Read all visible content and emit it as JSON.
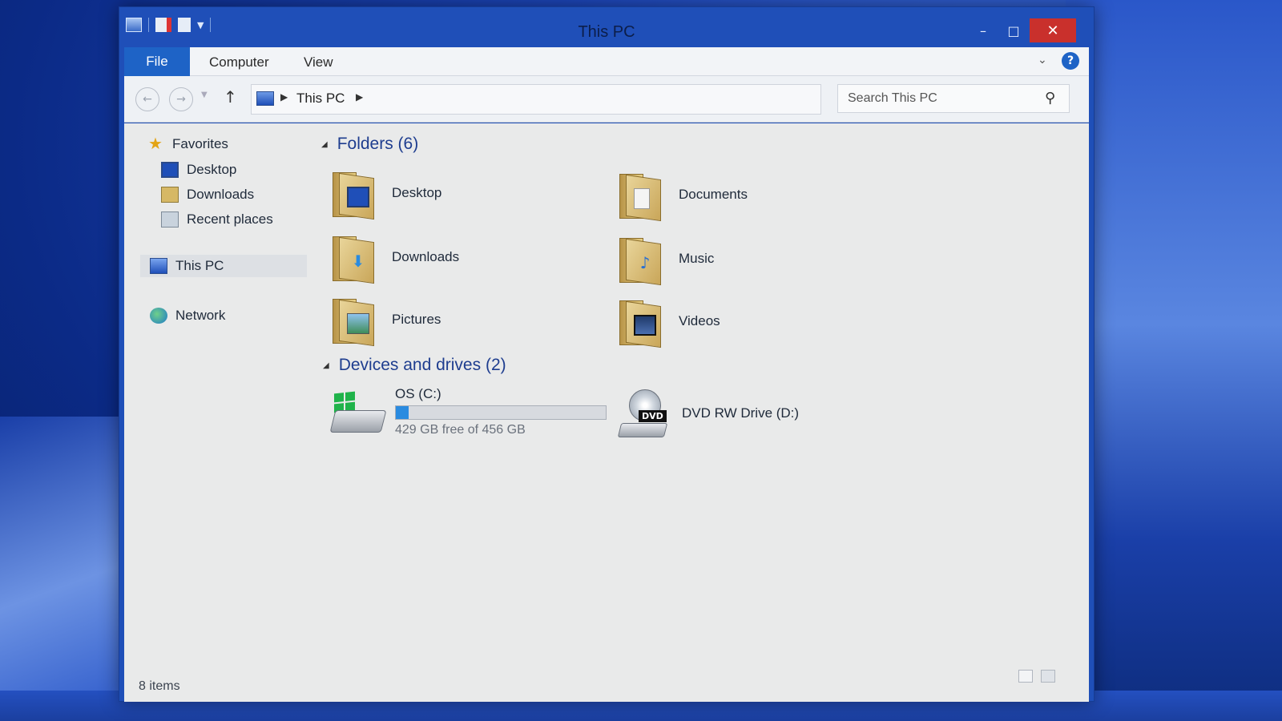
{
  "window": {
    "title": "This PC",
    "controls": {
      "minimize": "–",
      "maximize": "□",
      "close": "✕"
    }
  },
  "ribbon": {
    "tabs": [
      "File",
      "Computer",
      "View"
    ],
    "help": "?"
  },
  "address": {
    "crumb": "This PC",
    "search_placeholder": "Search This PC"
  },
  "nav_pane": {
    "favorites": {
      "label": "Favorites",
      "items": [
        "Desktop",
        "Downloads",
        "Recent places"
      ]
    },
    "this_pc": "This PC",
    "network": "Network"
  },
  "content": {
    "folders_header": "Folders (6)",
    "folders": [
      {
        "label": "Desktop",
        "icon": "desktop-icon"
      },
      {
        "label": "Documents",
        "icon": "documents-icon"
      },
      {
        "label": "Downloads",
        "icon": "downloads-icon"
      },
      {
        "label": "Music",
        "icon": "music-icon"
      },
      {
        "label": "Pictures",
        "icon": "pictures-icon"
      },
      {
        "label": "Videos",
        "icon": "videos-icon"
      }
    ],
    "drives_header": "Devices and drives (2)",
    "drives": [
      {
        "label": "OS (C:)",
        "free_text": "429 GB free of 456 GB",
        "used_fraction": 0.06
      },
      {
        "label": "DVD RW Drive (D:)",
        "badge": "DVD"
      }
    ]
  },
  "status": {
    "count": "8 items"
  },
  "colors": {
    "accent": "#1e63c6",
    "close": "#c9302c",
    "drive_fill": "#2a8be0"
  }
}
